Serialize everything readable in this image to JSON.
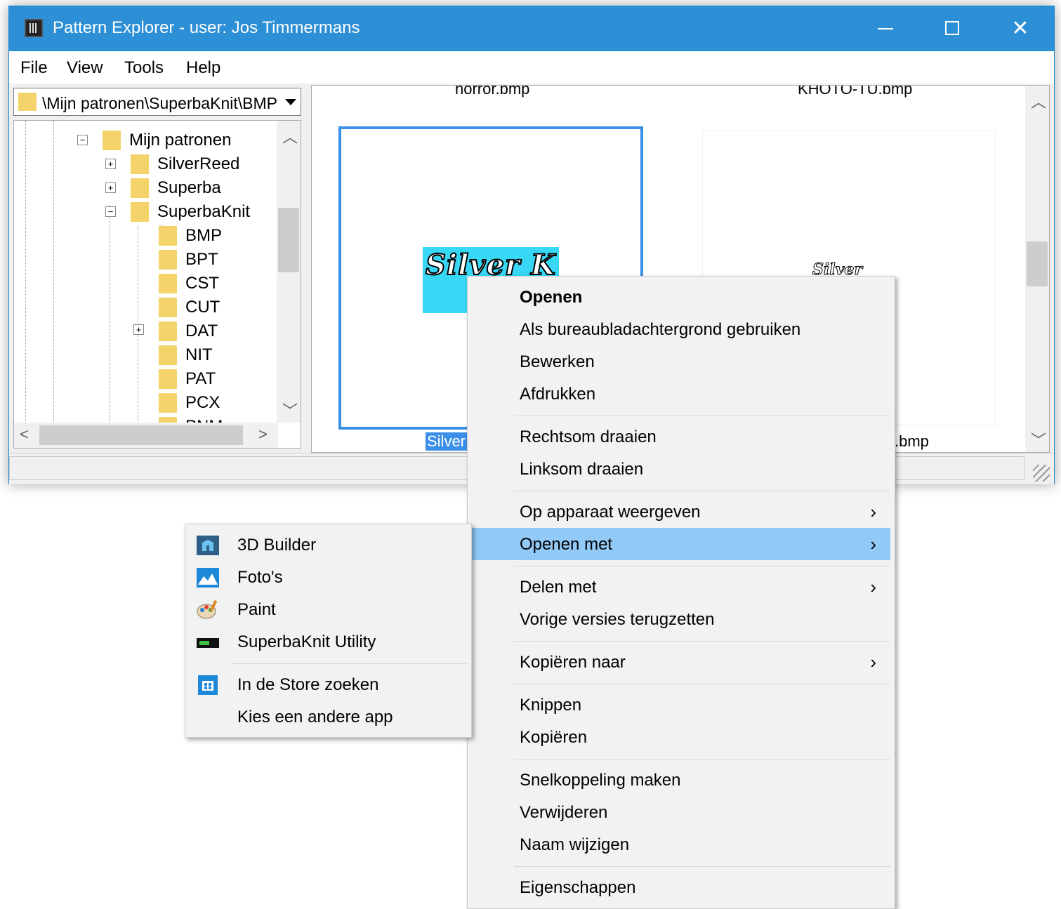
{
  "window": {
    "title": "Pattern Explorer - user: Jos Timmermans",
    "menu": [
      "File",
      "View",
      "Tools",
      "Help"
    ]
  },
  "path_combo": {
    "value": "\\Mijn patronen\\SuperbaKnit\\BMP"
  },
  "tree": {
    "items": [
      {
        "label": "Mijn patronen",
        "expander": "−"
      },
      {
        "label": "SilverReed",
        "expander": "+"
      },
      {
        "label": "Superba",
        "expander": "+"
      },
      {
        "label": "SuperbaKnit",
        "expander": "−"
      },
      {
        "label": "BMP",
        "expander": ""
      },
      {
        "label": "BPT",
        "expander": ""
      },
      {
        "label": "CST",
        "expander": ""
      },
      {
        "label": "CUT",
        "expander": ""
      },
      {
        "label": "DAT",
        "expander": "+"
      },
      {
        "label": "NIT",
        "expander": ""
      },
      {
        "label": "PAT",
        "expander": ""
      },
      {
        "label": "PCX",
        "expander": ""
      },
      {
        "label": "PNM",
        "expander": ""
      }
    ]
  },
  "thumbnails": {
    "top_labels": [
      "horror.bmp",
      "KHOTO-TU.bmp"
    ],
    "selected_art_text": "Silver K",
    "other_art_text": "Silver",
    "selected_caption": "Silver",
    "other_caption": ".bmp"
  },
  "context_menu": {
    "items": [
      {
        "label": "Openen",
        "bold": true
      },
      {
        "label": "Als bureaubladachtergrond gebruiken"
      },
      {
        "label": "Bewerken"
      },
      {
        "label": "Afdrukken"
      },
      {
        "label": "Rechtsom draaien"
      },
      {
        "label": "Linksom draaien"
      },
      {
        "label": "Op apparaat weergeven",
        "submenu": true
      },
      {
        "label": "Openen met",
        "submenu": true,
        "highlight": true
      },
      {
        "label": "Delen met",
        "submenu": true
      },
      {
        "label": "Vorige versies terugzetten"
      },
      {
        "label": "Kopiëren naar",
        "submenu": true
      },
      {
        "label": "Knippen"
      },
      {
        "label": "Kopiëren"
      },
      {
        "label": "Snelkoppeling maken"
      },
      {
        "label": "Verwijderen"
      },
      {
        "label": "Naam wijzigen"
      },
      {
        "label": "Eigenschappen"
      }
    ],
    "chevron": "›"
  },
  "open_with_menu": {
    "items": [
      {
        "label": "3D Builder",
        "icon": "3d-builder-icon"
      },
      {
        "label": "Foto's",
        "icon": "photos-icon"
      },
      {
        "label": "Paint",
        "icon": "paint-icon"
      },
      {
        "label": "SuperbaKnit Utility",
        "icon": "superbaknit-icon"
      },
      {
        "label": "In de Store zoeken",
        "icon": "store-icon"
      },
      {
        "label": "Kies een andere app",
        "icon": ""
      }
    ]
  },
  "colors": {
    "titlebar": "#2d8fd6",
    "highlight": "#91c9f7",
    "selection": "#3b8fe8",
    "folder": "#f5d36b"
  }
}
